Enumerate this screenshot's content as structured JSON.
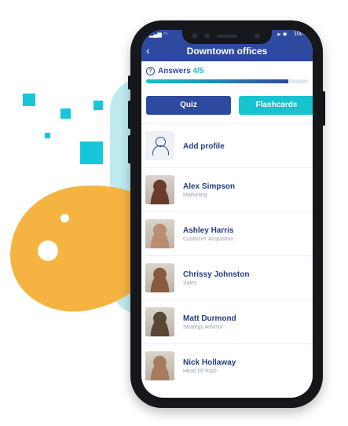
{
  "status": {
    "battery": "100%"
  },
  "header": {
    "title": "Downtown offices",
    "back_icon": "chevron-left-icon"
  },
  "answers": {
    "label": "Answers",
    "count": "4/5",
    "progress": 0.88
  },
  "tabs": [
    {
      "label": "Quiz"
    },
    {
      "label": "Flashcards"
    }
  ],
  "add_profile": {
    "label": "Add profile",
    "icon": "add-user-icon"
  },
  "people": [
    {
      "name": "Alex Simpson",
      "role": "Marketing",
      "avatar_color": "#6b3a2a"
    },
    {
      "name": "Ashley Harris",
      "role": "Customer Acquistion",
      "avatar_color": "#b98d6e"
    },
    {
      "name": "Chrissy Johnston",
      "role": "Sales",
      "avatar_color": "#8a5a3c"
    },
    {
      "name": "Matt Durmond",
      "role": "Strategy Advisor",
      "avatar_color": "#5a4636"
    },
    {
      "name": "Nick Hollaway",
      "role": "Head Of R&D",
      "avatar_color": "#a97a5c"
    }
  ],
  "colors": {
    "primary": "#2e4aa0",
    "accent": "#16c3cf",
    "orange": "#f5b341"
  }
}
